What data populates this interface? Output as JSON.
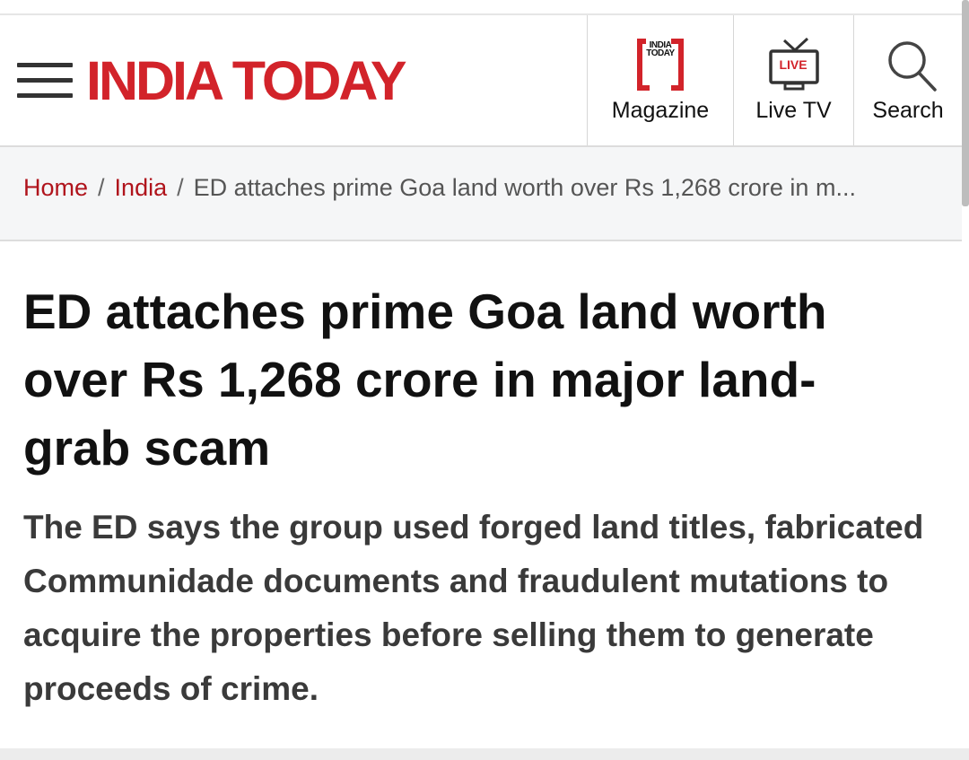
{
  "header": {
    "logo_text": "INDIA TODAY",
    "nav": {
      "magazine": {
        "label": "Magazine",
        "icon": "magazine-icon",
        "icon_text": "INDIA TODAY"
      },
      "live_tv": {
        "label": "Live TV",
        "icon": "tv-icon",
        "badge": "LIVE"
      },
      "search": {
        "label": "Search",
        "icon": "search-icon"
      }
    }
  },
  "breadcrumb": {
    "items": [
      "Home",
      "India"
    ],
    "separator": "/",
    "current": "ED attaches prime Goa land worth over Rs 1,268 crore in m..."
  },
  "article": {
    "headline": "ED attaches prime Goa land worth over Rs 1,268 crore in major land-grab scam",
    "summary": "The ED says the group used forged land titles, fabricated Communidade documents and fraudulent mutations to acquire the properties before selling them to generate proceeds of crime."
  },
  "colors": {
    "brand_red": "#d2232a",
    "link_red": "#b0141c",
    "text_dark": "#111111",
    "summary_gray": "#3a3a3a",
    "breadcrumb_bg": "#f5f6f7"
  }
}
